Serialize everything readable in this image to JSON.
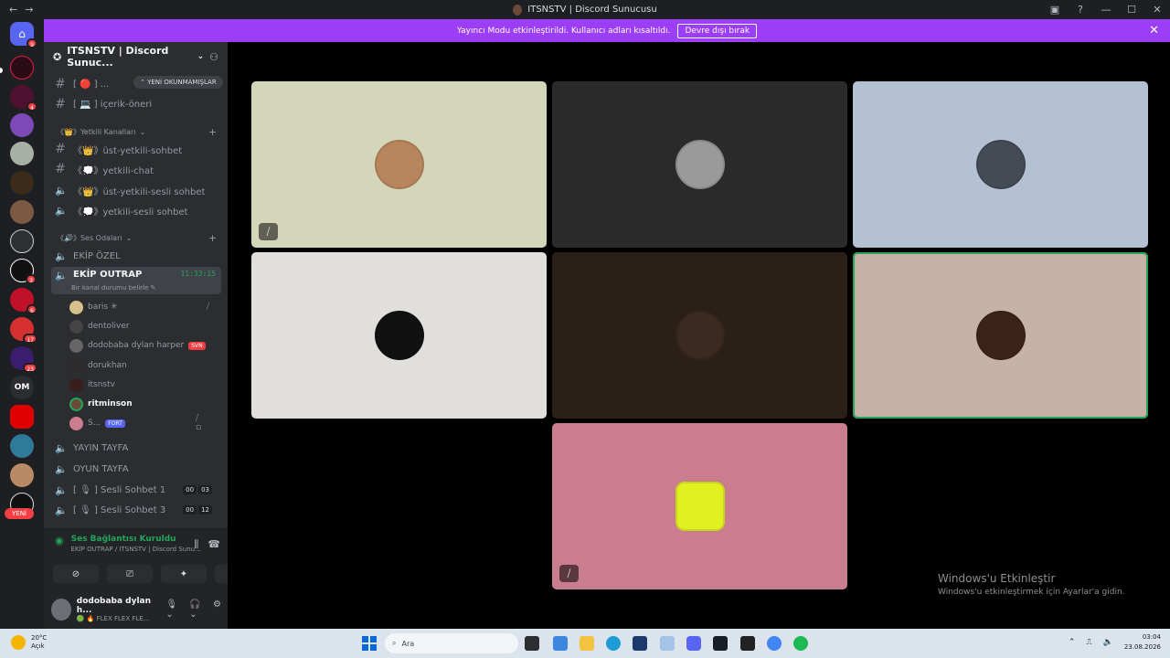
{
  "window": {
    "title": "ITSNSTV | Discord Sunucusu",
    "nav_back": "←",
    "nav_fwd": "→"
  },
  "banner": {
    "text": "Yayıncı Modu etkinleştirildi. Kullanıcı adları kısaltıldı.",
    "button": "Devre dışı bırak",
    "close": "✕"
  },
  "server": {
    "name": "ITSNSTV | Discord Sunuc...",
    "new_unread": "YENİ OKUNMAMIŞLAR"
  },
  "channels_top": [
    {
      "label": "[ 🔴 ] ...",
      "type": "text"
    },
    {
      "label": "[ 💻 ] içerik-öneri",
      "type": "text"
    }
  ],
  "categories": {
    "yetkili": "《👑》Yetkili Kanalları",
    "ses": "《🔊》Ses Odaları"
  },
  "yetkili_channels": [
    {
      "label": "《👑》üst-yetkili-sohbet",
      "type": "text"
    },
    {
      "label": "《💭》yetkili-chat",
      "type": "text"
    },
    {
      "label": "《👑》üst-yetkili-sesli sohbet",
      "type": "voice"
    },
    {
      "label": "《💭》yetkili-sesli sohbet",
      "type": "voice"
    }
  ],
  "voice_channels": [
    {
      "label": "EKİP ÖZEL"
    },
    {
      "label": "EKİP OUTRAP",
      "time": "11:33:15",
      "status": "Bir kanal durumu belirle ✎"
    }
  ],
  "voice_users": [
    {
      "name": "baris ✳",
      "muted": true
    },
    {
      "name": "dentoliver"
    },
    {
      "name": "dodobaba dylan harper",
      "tag": "SVN"
    },
    {
      "name": "dorukhan"
    },
    {
      "name": "itsnstv"
    },
    {
      "name": "ritminson",
      "bright": true
    },
    {
      "name": "S...",
      "tag": "FORT",
      "muted": true
    }
  ],
  "voice_channels_bottom": [
    {
      "label": "YAYIN TAYFA"
    },
    {
      "label": "OYUN TAYFA"
    },
    {
      "label": "[ 🎙 ] Sesli Sohbet 1",
      "count_a": "00",
      "count_b": "03"
    },
    {
      "label": "[ 🎙 ] Sesli Sohbet 3",
      "count_a": "00",
      "count_b": "12"
    }
  ],
  "connection": {
    "status": "Ses Bağlantısı Kuruldu",
    "location": "EKİP OUTRAP / ITSNSTV | Discord Sunu...",
    "btn_camera": "⊘",
    "btn_share": "⎚",
    "btn_activity": "✦",
    "btn_soundboard": "♪"
  },
  "me": {
    "name": "dodobaba dylan h...",
    "status": "🟢 🔥 FLEX FLEX FLE..."
  },
  "rail_new_label": "YENİ",
  "rail_om": "OM",
  "server_badges": [
    "9",
    "4",
    "3",
    "6",
    "17",
    "23"
  ],
  "tiles": [
    {
      "bg": "#d4d6ba",
      "face": "#b8865e",
      "muted": true
    },
    {
      "bg": "#2b2a2a",
      "face": "#9a9a9a"
    },
    {
      "bg": "#b4c1d3",
      "face": "#444b55"
    },
    {
      "bg": "#e0dfdc",
      "face": "#111111"
    },
    {
      "bg": "#2a2018",
      "face": "#3a2a20"
    },
    {
      "bg": "#c8b2a5",
      "face": "#3b2417",
      "speaking": true
    },
    {
      "bg": "#c97d8e",
      "face": "#e0f020",
      "muted": true
    }
  ],
  "watermark": {
    "title": "Windows'u Etkinleştir",
    "sub": "Windows'u etkinleştirmek için Ayarlar'a gidin."
  },
  "taskbar": {
    "temp": "20°C",
    "weather": "Açık",
    "search_placeholder": "Ara",
    "time": "03:04",
    "date": "23.08.2026"
  }
}
